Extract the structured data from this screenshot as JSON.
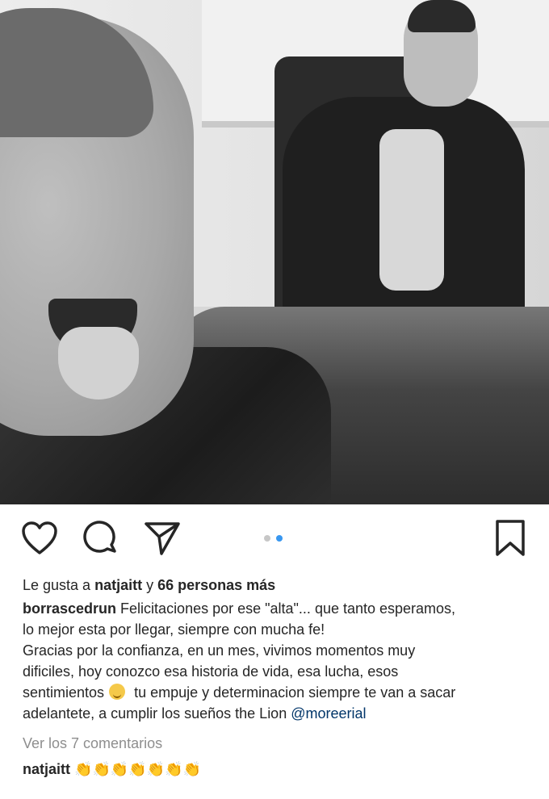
{
  "post": {
    "image_alt": "",
    "carousel": {
      "count": 2,
      "active_index": 1,
      "active_color": "#3897f0",
      "inactive_color": "#c7c7c7"
    }
  },
  "actions": {
    "icons": [
      "heart-icon",
      "comment-icon",
      "share-icon",
      "bookmark-icon"
    ]
  },
  "likes": {
    "prefix": "Le gusta a ",
    "user": "natjaitt",
    "middle": " y ",
    "others": "66 personas más"
  },
  "caption": {
    "user": "borrascedrun",
    "line1": " Felicitaciones por ese \"alta\"... que tanto esperamos,",
    "line2": "lo mejor esta por llegar, siempre con mucha fe!",
    "line3": "Gracias por la confianza, en un mes, vivimos momentos muy",
    "line4": "dificiles, hoy conozco esa historia de vida, esa lucha, esos",
    "line5a": "sentimientos",
    "line5b": " tu empuje y determinacion siempre te van a sacar",
    "line6": "adelantete, a cumplir los sueños the Lion ",
    "mention": "@moreerial",
    "emoji": "smiling-face-emoji"
  },
  "view_comments": "Ver los 7 comentarios",
  "comment": {
    "user": "natjaitt",
    "text": "👏👏👏👏👏👏👏"
  }
}
